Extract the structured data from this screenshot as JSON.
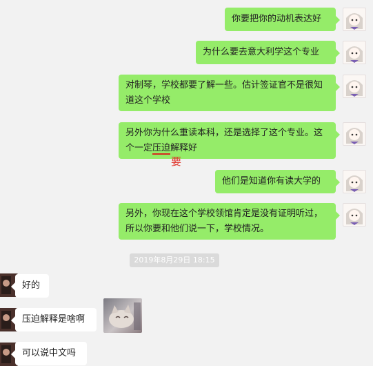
{
  "messages": [
    {
      "side": "me",
      "text": "你要把你的动机表达好"
    },
    {
      "side": "me",
      "text": "为什么要去意大利学这个专业"
    },
    {
      "side": "me",
      "text": "对制琴，学校都要了解一些。估计签证官不是很知道这个学校"
    },
    {
      "side": "me",
      "text_before": "另外你为什么重读本科，还是选择了这个专业。这个一定",
      "text_marked": "压迫",
      "text_after": "解释好",
      "annotation": "要"
    },
    {
      "side": "me",
      "text": "他们是知道你有读大学的"
    },
    {
      "side": "me",
      "text": "另外，你现在这个学校领馆肯定是没有证明听过，所以你要和他们说一下，学校情况。"
    },
    {
      "side": "other",
      "text": "好的"
    },
    {
      "side": "other",
      "text": "压迫解释是啥啊"
    },
    {
      "side": "other",
      "text": "可以说中文吗"
    }
  ],
  "timestamp": "2019年8月29日 18:15",
  "colors": {
    "my_bubble": "#95ec69",
    "their_bubble": "#ffffff",
    "background": "#f2f2f2",
    "annotation": "#e0332a"
  },
  "icons": {
    "my_avatar": "anime-girl-avatar",
    "their_avatar": "photo-avatar",
    "sticker": "cat-photo-sticker"
  }
}
